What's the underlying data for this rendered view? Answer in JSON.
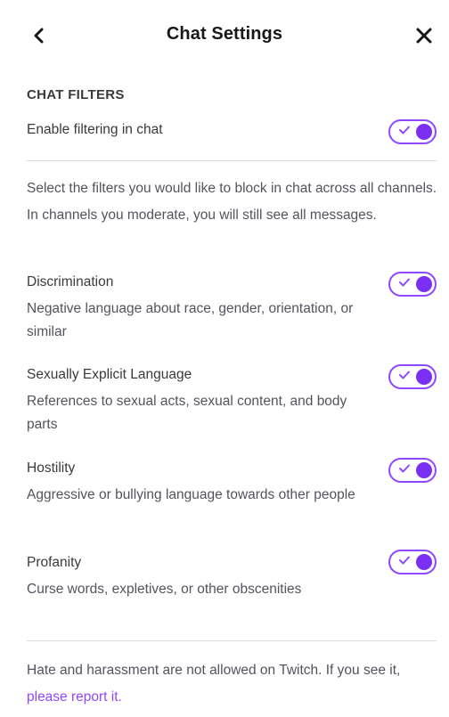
{
  "header": {
    "title": "Chat Settings",
    "back_icon": "chevron-left-icon",
    "close_icon": "close-icon"
  },
  "chat_filters": {
    "section_title": "CHAT FILTERS",
    "enable_label": "Enable filtering in chat",
    "enable_on": true
  },
  "intro_text": "Select the filters you would like to block in chat across all channels. In channels you moderate, you will still see all messages.",
  "filters": [
    {
      "label": "Discrimination",
      "description": "Negative language about race, gender, orientation, or similar",
      "on": true
    },
    {
      "label": "Sexually Explicit Language",
      "description": "References to sexual acts, sexual content, and body parts",
      "on": true
    },
    {
      "label": "Hostility",
      "description": "Aggressive or bullying language towards other people",
      "on": true
    },
    {
      "label": "Profanity",
      "description": "Curse words, expletives, or other obscenities",
      "on": true
    }
  ],
  "footer": {
    "text": "Hate and harassment are not allowed on Twitch. If you see it,",
    "link_text": "please report it."
  },
  "colors": {
    "accent": "#9147ff",
    "knob": "#7a2ff2",
    "text_primary": "#18181b",
    "text_secondary": "#53535f",
    "divider": "#dcdce0"
  }
}
